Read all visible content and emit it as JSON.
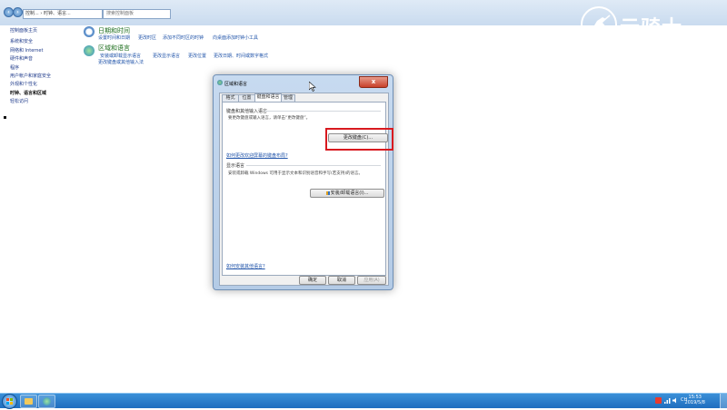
{
  "colors": {
    "accent": "#2255aa",
    "category_title": "#1e6e1e",
    "highlight": "#d8191f",
    "taskbar": "#1f6ebf"
  },
  "addressbar": {
    "path": "控制... › 时钟、语言...",
    "search_placeholder": "搜索控制面板"
  },
  "sidebar": {
    "items": [
      {
        "label": "控制面板主页",
        "active": false
      },
      {
        "label": "系统和安全",
        "active": false
      },
      {
        "label": "网络和 Internet",
        "active": false
      },
      {
        "label": "硬件和声音",
        "active": false
      },
      {
        "label": "程序",
        "active": false
      },
      {
        "label": "用户帐户和家庭安全",
        "active": false
      },
      {
        "label": "外观和个性化",
        "active": false
      },
      {
        "label": "时钟、语言和区域",
        "active": true
      },
      {
        "label": "轻松访问",
        "active": false
      }
    ]
  },
  "categories": [
    {
      "title": "日期和时间",
      "icon": "clock-icon",
      "links": [
        "设置时间和日期",
        "更改时区",
        "添加不同时区的时钟",
        "向桌面添加时钟小工具"
      ]
    },
    {
      "title": "区域和语言",
      "icon": "globe-icon",
      "links": [
        "安装或卸载显示语言",
        "更改显示语言",
        "更改位置",
        "更改日期、时间或数字格式",
        "更改键盘或其他输入法"
      ]
    }
  ],
  "logo": {
    "text": "云骑士",
    "icon": "knight-rider-icon"
  },
  "dialog": {
    "title": "区域和语言",
    "close_label": "x",
    "tabs": [
      "格式",
      "位置",
      "键盘和语言",
      "管理"
    ],
    "active_tab": 2,
    "keyboard_group": {
      "label": "键盘和其他输入语言",
      "description": "要更改键盘或输入语言，请单击“更改键盘”。",
      "button": "更改键盘(C)...",
      "link": "如何更改欢迎屏幕的键盘布局?"
    },
    "display_group": {
      "label": "显示语言",
      "description": "安装或卸载 Windows 可用于显示文本和识别语音和手写(若支持)的语言。",
      "button": "安装/卸载语言(I)..."
    },
    "help_link": "如何安装其他语言?",
    "buttons": {
      "ok": "确定",
      "cancel": "取消",
      "apply": "应用(A)"
    }
  },
  "taskbar": {
    "apps": [
      "explorer-icon",
      "control-panel-icon"
    ],
    "tray": {
      "time": "15:53",
      "date": "2019/5/8",
      "language": "CH"
    }
  }
}
